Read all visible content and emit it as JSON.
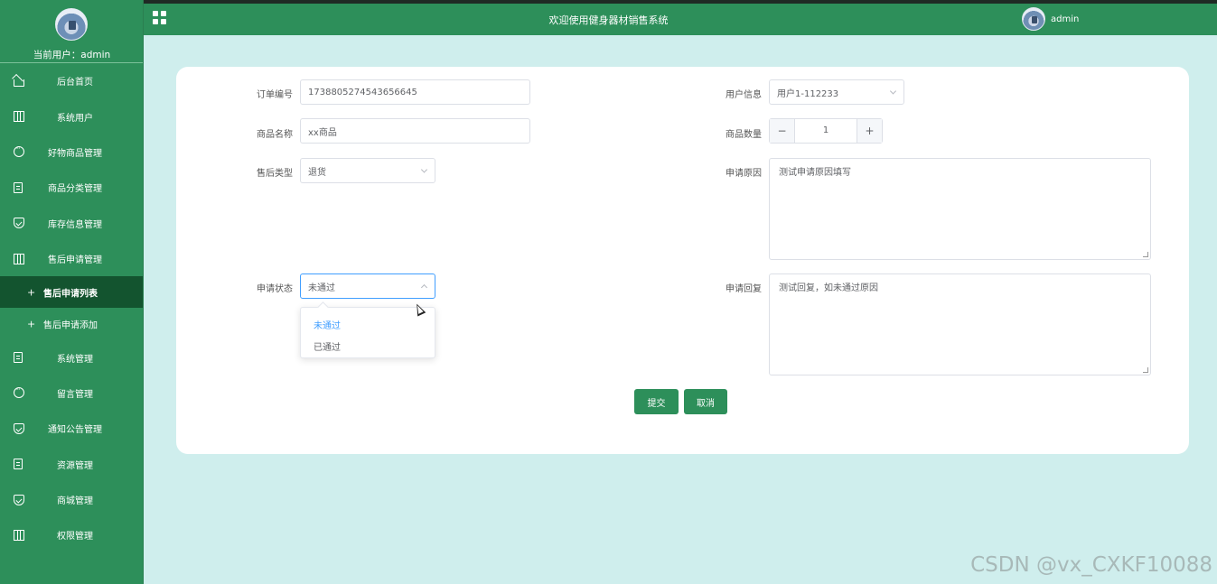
{
  "header": {
    "title": "欢迎使用健身器材销售系统",
    "username": "admin"
  },
  "sidebar": {
    "current_user_label": "当前用户：",
    "current_user": "admin",
    "items": [
      {
        "label": "后台首页",
        "icon": "home-icon"
      },
      {
        "label": "系统用户",
        "icon": "columns-icon"
      },
      {
        "label": "好物商品管理",
        "icon": "chat-icon"
      },
      {
        "label": "商品分类管理",
        "icon": "document-icon"
      },
      {
        "label": "库存信息管理",
        "icon": "shield-check-icon"
      },
      {
        "label": "售后申请管理",
        "icon": "columns-icon"
      }
    ],
    "sub_items": [
      {
        "label": "售后申请列表",
        "active": true
      },
      {
        "label": "售后申请添加",
        "active": false
      }
    ],
    "items_after": [
      {
        "label": "系统管理",
        "icon": "document-icon"
      },
      {
        "label": "留言管理",
        "icon": "chat-icon"
      },
      {
        "label": "通知公告管理",
        "icon": "shield-check-icon"
      },
      {
        "label": "资源管理",
        "icon": "document-icon"
      },
      {
        "label": "商城管理",
        "icon": "shield-check-icon"
      },
      {
        "label": "权限管理",
        "icon": "columns-icon"
      }
    ]
  },
  "form": {
    "order_no_label": "订单编号",
    "order_no_value": "1738805274543656645",
    "user_info_label": "用户信息",
    "user_info_value": "用户1-112233",
    "product_name_label": "商品名称",
    "product_name_value": "xx商品",
    "quantity_label": "商品数量",
    "quantity_value": "1",
    "aftersale_type_label": "售后类型",
    "aftersale_type_value": "退货",
    "reason_label": "申请原因",
    "reason_value": "测试申请原因填写",
    "status_label": "申请状态",
    "status_value": "未通过",
    "reply_label": "申请回复",
    "reply_value": "测试回复，如未通过原因",
    "status_options": [
      "未通过",
      "已通过"
    ],
    "submit_label": "提交",
    "cancel_label": "取消"
  },
  "colors": {
    "primary": "#2d8f5a",
    "active_menu": "#13542f",
    "background": "#cfeeed",
    "selected_option": "#409eff"
  },
  "watermark": "CSDN @vx_CXKF10088"
}
